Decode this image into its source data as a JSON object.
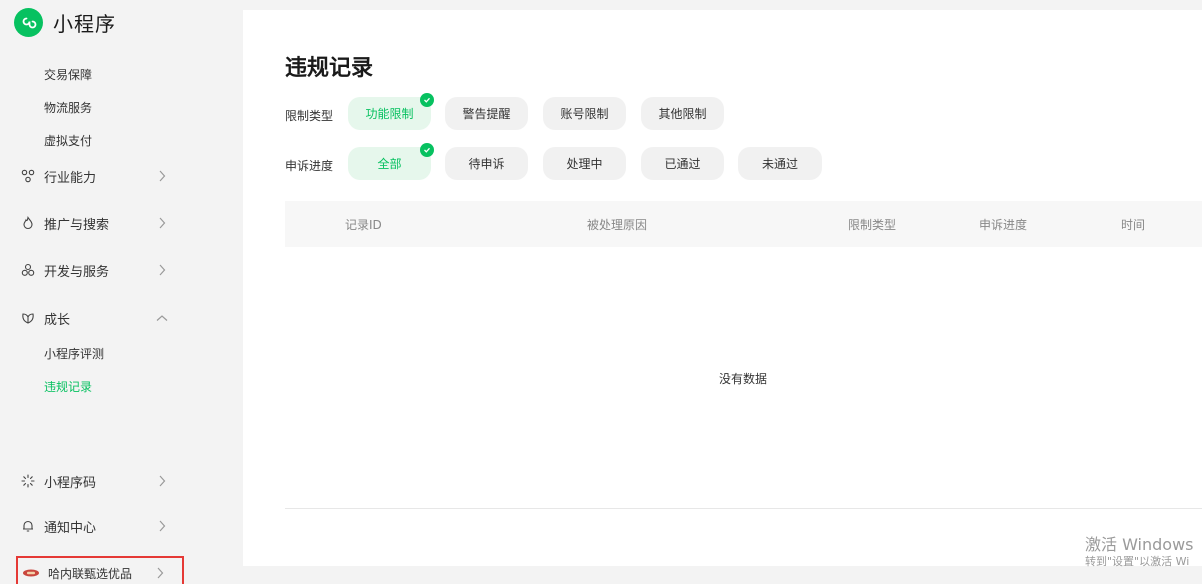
{
  "app": {
    "title": "小程序"
  },
  "sidebar": {
    "sub_items_top": [
      "交易保障",
      "物流服务",
      "虚拟支付"
    ],
    "groups": [
      {
        "label": "行业能力",
        "icon": "nodes-icon"
      },
      {
        "label": "推广与搜索",
        "icon": "flame-icon"
      },
      {
        "label": "开发与服务",
        "icon": "cluster-icon"
      },
      {
        "label": "成长",
        "icon": "leaf-icon"
      }
    ],
    "growth_items": [
      {
        "label": "小程序评测",
        "active": false
      },
      {
        "label": "违规记录",
        "active": true
      }
    ],
    "bottom": [
      {
        "label": "小程序码",
        "icon": "sun-icon"
      },
      {
        "label": "通知中心",
        "icon": "bell-icon"
      },
      {
        "label": "哈内联甄选优品",
        "icon": "avatar-badge-icon"
      }
    ]
  },
  "main": {
    "title": "违规记录",
    "filters": {
      "restriction": {
        "label": "限制类型",
        "options": [
          "功能限制",
          "警告提醒",
          "账号限制",
          "其他限制"
        ],
        "selected": "功能限制"
      },
      "appeal": {
        "label": "申诉进度",
        "options": [
          "全部",
          "待申诉",
          "处理中",
          "已通过",
          "未通过"
        ],
        "selected": "全部"
      }
    },
    "table": {
      "columns": [
        "记录ID",
        "被处理原因",
        "限制类型",
        "申诉进度",
        "时间"
      ],
      "empty_text": "没有数据"
    }
  },
  "watermark": {
    "line1": "激活 Windows",
    "line2": "转到\"设置\"以激活 Wi"
  },
  "colors": {
    "accent": "#07c160",
    "highlight": "#e53935"
  }
}
